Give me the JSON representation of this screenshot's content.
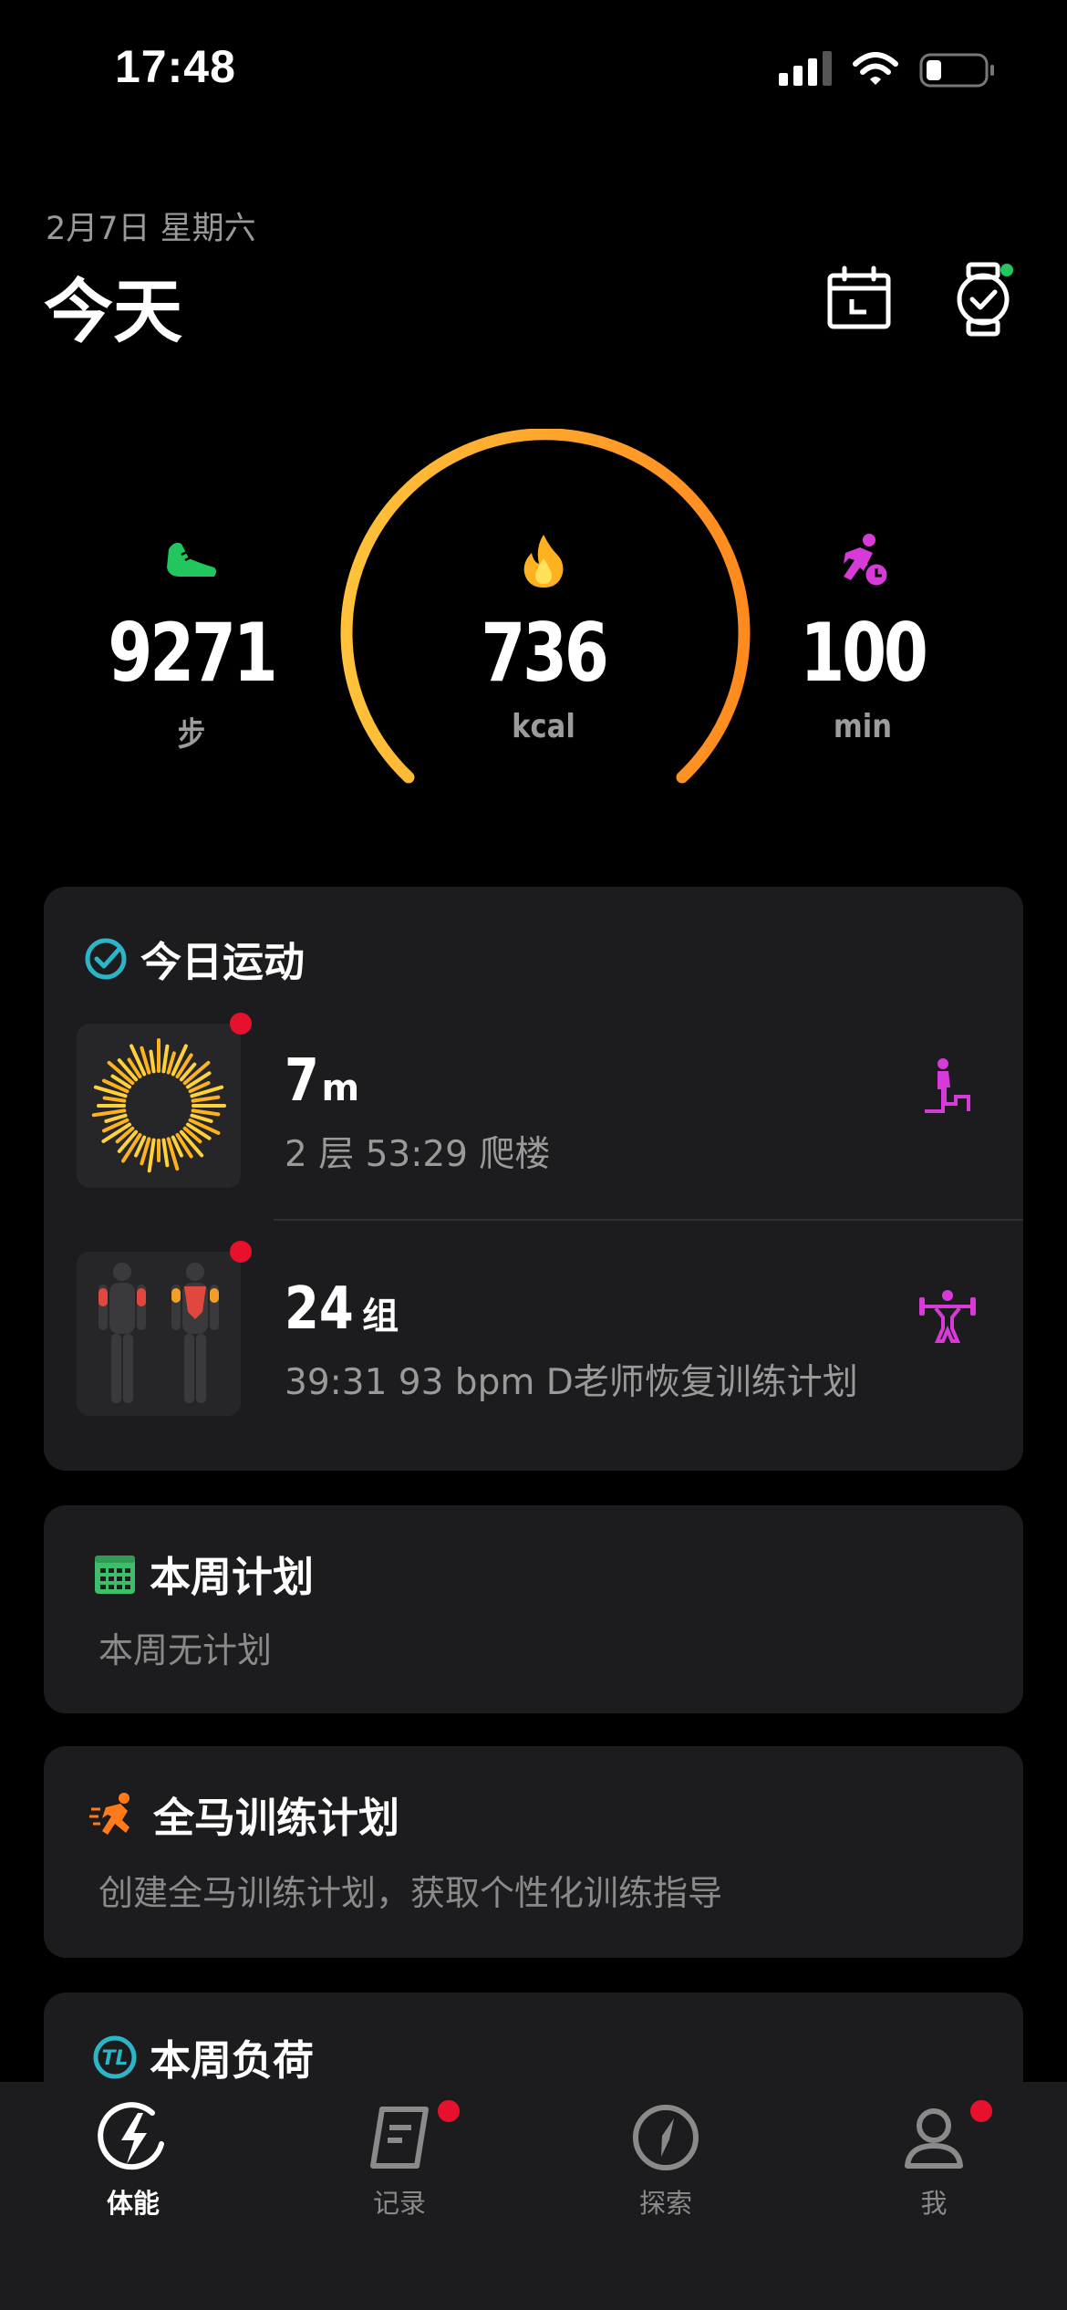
{
  "status": {
    "time": "17:48"
  },
  "header": {
    "date": "2月7日 星期六",
    "title": "今天"
  },
  "summary": {
    "steps": {
      "value": "9271",
      "unit": "步",
      "icon": "shoe-icon"
    },
    "calories": {
      "value": "736",
      "unit": "kcal",
      "icon": "flame-icon"
    },
    "active": {
      "value": "100",
      "unit": "min",
      "icon": "running-clock-icon"
    },
    "colors": {
      "ring_start": "#FFC23A",
      "ring_end": "#FF8A1E",
      "steps": "#22C55E",
      "active": "#D63BD8"
    }
  },
  "today": {
    "title": "今日运动",
    "activities": [
      {
        "value": "7",
        "unit": "m",
        "desc": "2 层  53:29  爬楼",
        "type_icon": "stair-climb-icon"
      },
      {
        "value": "24",
        "unit": "组",
        "desc": "39:31  93 bpm  D老师恢复训练计划",
        "type_icon": "weightlifting-icon"
      }
    ]
  },
  "week_plan": {
    "title": "本周计划",
    "subtitle": "本周无计划"
  },
  "marathon": {
    "title": "全马训练计划",
    "subtitle": "创建全马训练计划，获取个性化训练指导"
  },
  "load": {
    "title": "本周负荷"
  },
  "tabs": [
    {
      "label": "体能",
      "icon": "bolt-icon",
      "active": true
    },
    {
      "label": "记录",
      "icon": "record-icon",
      "active": false
    },
    {
      "label": "探索",
      "icon": "compass-icon",
      "active": false
    },
    {
      "label": "我",
      "icon": "profile-icon",
      "active": false
    }
  ]
}
